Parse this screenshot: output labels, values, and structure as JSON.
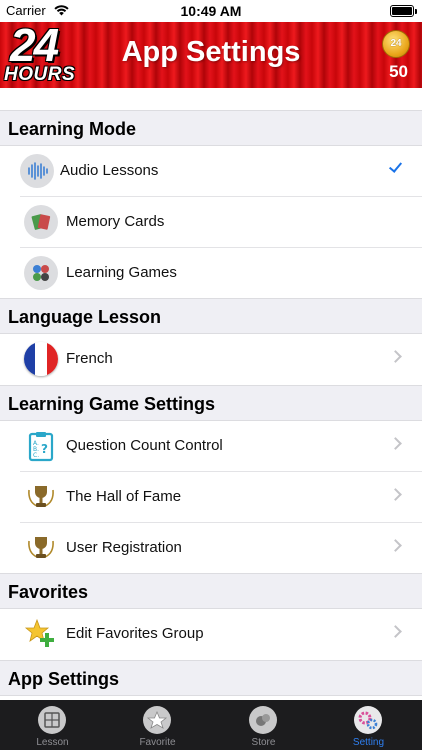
{
  "status_bar": {
    "carrier": "Carrier",
    "time": "10:49 AM"
  },
  "header": {
    "logo_number": "24",
    "logo_word": "HOURS",
    "title": "App Settings",
    "coin_label": "24",
    "coin_count": "50"
  },
  "sections": {
    "learning_mode": {
      "title": "Learning Mode",
      "items": [
        {
          "label": "Audio Lessons",
          "icon": "audio-wave-icon",
          "selected": true
        },
        {
          "label": "Memory Cards",
          "icon": "memory-cards-icon"
        },
        {
          "label": "Learning Games",
          "icon": "game-controller-icon"
        }
      ]
    },
    "language_lesson": {
      "title": "Language Lesson",
      "items": [
        {
          "label": "French",
          "icon": "french-flag-icon"
        }
      ]
    },
    "learning_game_settings": {
      "title": "Learning Game Settings",
      "items": [
        {
          "label": "Question Count Control",
          "icon": "clipboard-icon"
        },
        {
          "label": "The Hall of Fame",
          "icon": "trophy-icon"
        },
        {
          "label": "User Registration",
          "icon": "trophy-icon"
        }
      ]
    },
    "favorites": {
      "title": "Favorites",
      "items": [
        {
          "label": "Edit Favorites Group",
          "icon": "star-plus-icon"
        }
      ]
    },
    "app_settings": {
      "title": "App Settings"
    }
  },
  "tabbar": {
    "tabs": [
      {
        "label": "Lesson",
        "icon": "lesson-icon"
      },
      {
        "label": "Favorite",
        "icon": "star-icon"
      },
      {
        "label": "Store",
        "icon": "store-icon"
      },
      {
        "label": "Setting",
        "icon": "gear-icon",
        "active": true
      }
    ]
  },
  "colors": {
    "header_red": "#d10b10",
    "accent_blue": "#2f7ff0",
    "section_bg": "#efeff4",
    "tabbar_bg": "#1c1c1e"
  }
}
